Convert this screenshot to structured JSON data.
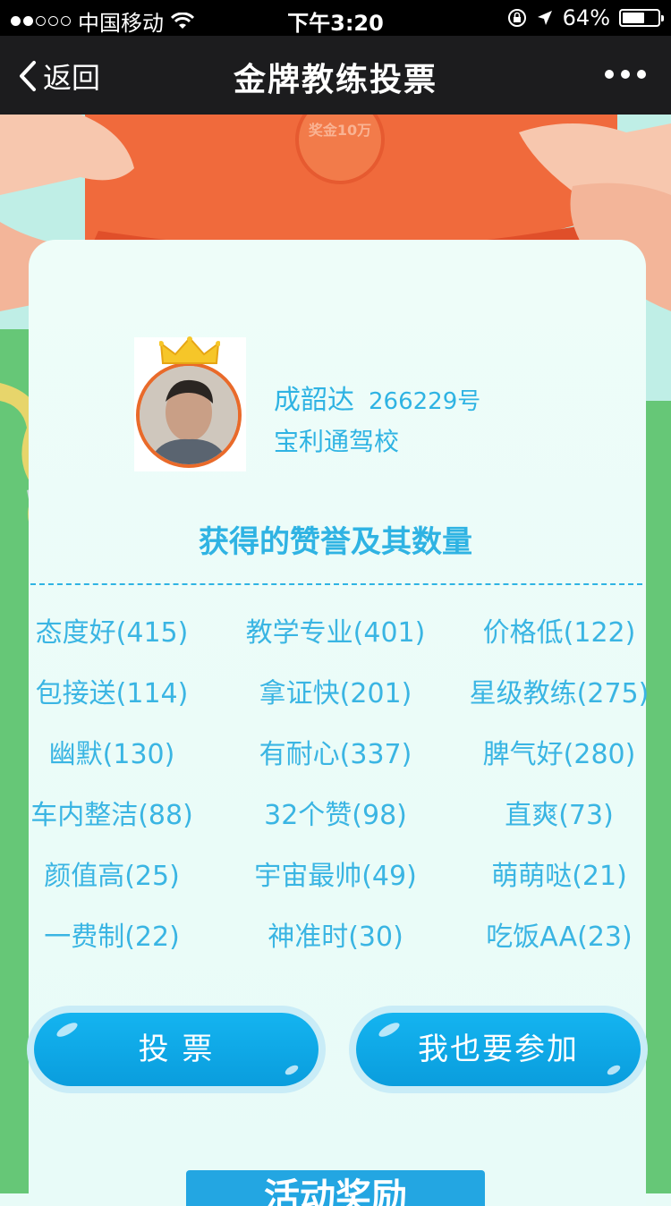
{
  "status_bar": {
    "carrier": "中国移动",
    "time": "下午3:20",
    "battery": "64%",
    "battery_level": 0.64
  },
  "nav": {
    "back_label": "返回",
    "title": "金牌教练投票"
  },
  "banner": {
    "envelope_text": "奖金10万"
  },
  "coach": {
    "name": "成韶达",
    "number": "266229号",
    "school": "宝利通驾校"
  },
  "praise": {
    "title": "获得的赞誉及其数量",
    "tags": [
      "态度好(415)",
      "教学专业(401)",
      "价格低(122)",
      "包接送(114)",
      "拿证快(201)",
      "星级教练(275)",
      "幽默(130)",
      "有耐心(337)",
      "脾气好(280)",
      "车内整洁(88)",
      "32个赞(98)",
      "直爽(73)",
      "颜值高(25)",
      "宇宙最帅(49)",
      "萌萌哒(21)",
      "一费制(22)",
      "神准时(30)",
      "吃饭AA(23)"
    ]
  },
  "buttons": {
    "vote": "投 票",
    "join": "我也要参加"
  },
  "footer": {
    "section_label": "活动奖励"
  },
  "colors": {
    "accent": "#2fb3e3",
    "button": "#0fa8e8",
    "banner_red": "#f06a3c",
    "card_bg": "#eefdf9"
  }
}
